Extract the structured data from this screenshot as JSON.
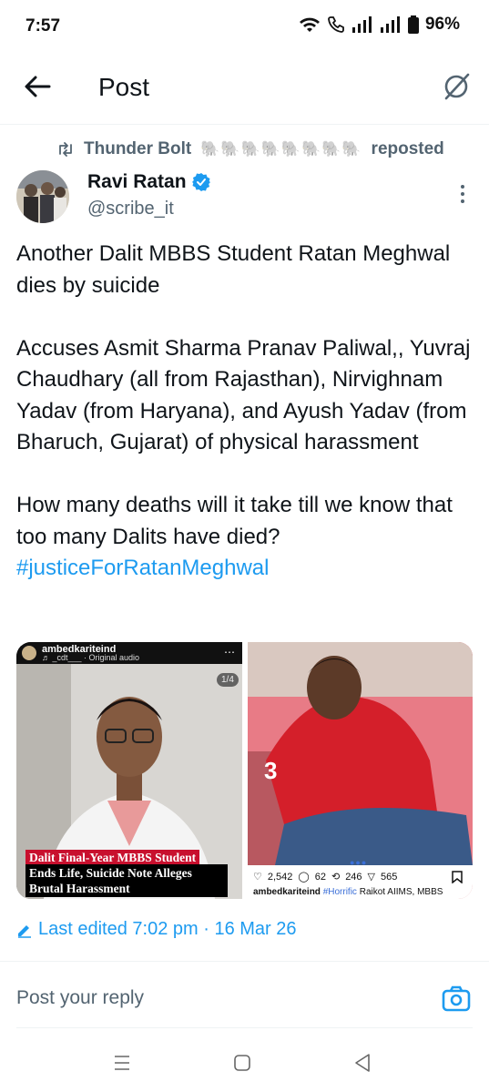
{
  "status_bar": {
    "time": "7:57",
    "battery": "96%"
  },
  "header": {
    "title": "Post"
  },
  "repost": {
    "user": "Thunder Bolt",
    "emoji": "🐘🐘🐘🐘🐘🐘🐘🐘",
    "label": "reposted"
  },
  "author": {
    "name": "Ravi Ratan",
    "handle": "@scribe_it"
  },
  "post": {
    "p1": "Another Dalit MBBS Student Ratan Meghwal dies by suicide",
    "p2": "Accuses Asmit Sharma Pranav Paliwal,, Yuvraj Chaudhary (all from Rajasthan), Nirvighnam Yadav (from Haryana), and Ayush Yadav (from Bharuch, Gujarat) of physical harassment",
    "p3": "How many deaths will it take till we know that too many Dalits have died?",
    "hashtag": "#justiceForRatanMeghwal"
  },
  "media": {
    "left": {
      "account": "ambedkariteind",
      "audio": "♬ _cdt___ · Original audio",
      "counter": "1/4",
      "caption_red": "Dalit Final-Year MBBS Student",
      "caption_black": "Ends Life, Suicide Note Alleges Brutal Harassment"
    },
    "right": {
      "likes": "2,542",
      "comments": "62",
      "reposts": "246",
      "shares": "565",
      "caption_user": "ambedkariteind",
      "caption_hashtag": "#Horrific",
      "caption_text": "Raikot AIIMS, MBBS"
    }
  },
  "edited": {
    "text": "Last edited 7:02 pm · 16 Mar 26"
  },
  "reply": {
    "placeholder": "Post your reply"
  },
  "icons": {
    "back": "arrow-left-icon",
    "grok": "grok-icon",
    "repost": "repost-icon",
    "verified": "verified-badge-icon",
    "more": "more-vertical-icon",
    "edit": "pencil-icon",
    "camera": "camera-icon"
  },
  "colors": {
    "accent": "#1d9bf0",
    "secondary_text": "#536471",
    "caption_red": "#c8102e"
  }
}
